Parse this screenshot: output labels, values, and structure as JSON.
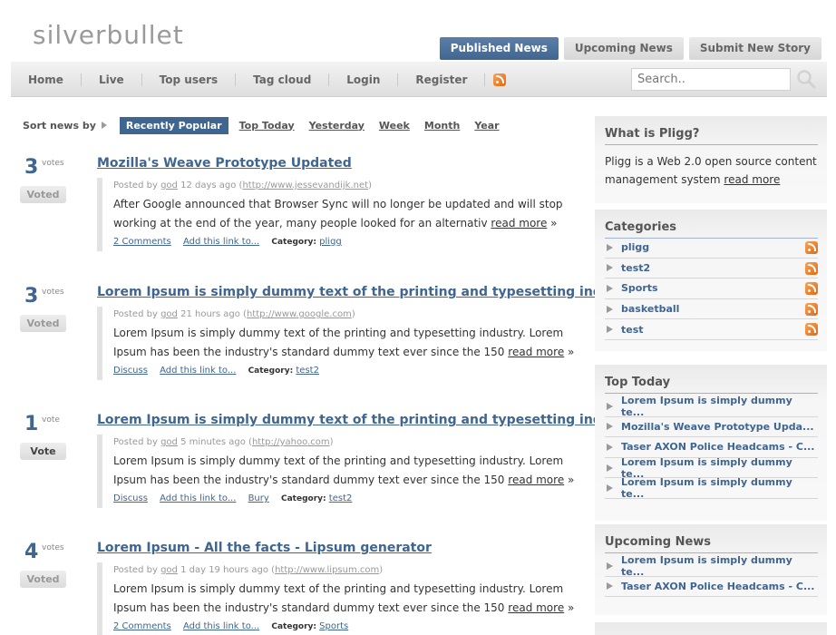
{
  "site": {
    "logo": "silverbullet"
  },
  "top_tabs": [
    {
      "label": "Published News",
      "active": true
    },
    {
      "label": "Upcoming News",
      "active": false
    },
    {
      "label": "Submit New Story",
      "active": false
    }
  ],
  "nav": {
    "items": [
      "Home",
      "Live",
      "Top users",
      "Tag cloud",
      "Login",
      "Register"
    ],
    "search_placeholder": "Search.."
  },
  "sort": {
    "label": "Sort news by",
    "options": [
      "Recently Popular",
      "Top Today",
      "Yesterday",
      "Week",
      "Month",
      "Year"
    ],
    "active": "Recently Popular"
  },
  "stories": [
    {
      "votes": "3",
      "vote_word": "votes",
      "button": "Voted",
      "title": "Mozilla's Weave Prototype Updated",
      "posted_by": "Posted by",
      "author": "god",
      "age": "12 days ago",
      "url": "http://www.jessevandijk.net",
      "excerpt": "After Google announced that Browser Sync will no longer be updated and will stop working at the end of the year, many people looked for an alternativ",
      "read_more": "read more",
      "links": [
        "2 Comments",
        "Add this link to..."
      ],
      "category_label": "Category:",
      "category": "pligg"
    },
    {
      "votes": "3",
      "vote_word": "votes",
      "button": "Voted",
      "title": "Lorem Ipsum is simply dummy text of the printing and typesetting industry.",
      "posted_by": "Posted by",
      "author": "god",
      "age": "21 hours ago",
      "url": "http://www.google.com",
      "excerpt": "Lorem Ipsum is simply dummy text of the printing and typesetting industry. Lorem Ipsum has been the industry's standard dummy text ever since the 150",
      "read_more": "read more",
      "links": [
        "Discuss",
        "Add this link to..."
      ],
      "category_label": "Category:",
      "category": "test2"
    },
    {
      "votes": "1",
      "vote_word": "vote",
      "button": "Vote",
      "title": "Lorem Ipsum is simply dummy text of the printing and typesetting industry.",
      "posted_by": "Posted by",
      "author": "god",
      "age": "5 minutes ago",
      "url": "http://yahoo.com",
      "excerpt": "Lorem Ipsum is simply dummy text of the printing and typesetting industry. Lorem Ipsum has been the industry's standard dummy text ever since the 150",
      "read_more": "read more",
      "links": [
        "Discuss",
        "Add this link to...",
        "Bury"
      ],
      "category_label": "Category:",
      "category": "test2"
    },
    {
      "votes": "4",
      "vote_word": "votes",
      "button": "Voted",
      "title": "Lorem Ipsum - All the facts - Lipsum generator",
      "posted_by": "Posted by",
      "author": "god",
      "age": "1 day 19 hours ago",
      "url": "http://www.lipsum.com",
      "excerpt": "Lorem Ipsum is simply dummy text of the printing and typesetting industry. Lorem Ipsum has been the industry's standard dummy text ever since the 150",
      "read_more": "read more",
      "links": [
        "2 Comments",
        "Add this link to..."
      ],
      "category_label": "Category:",
      "category": "Sports"
    }
  ],
  "sidebar": {
    "about": {
      "title": "What is Pligg?",
      "text": "Pligg is a Web 2.0 open source content management system",
      "read_more": "read more"
    },
    "categories": {
      "title": "Categories",
      "items": [
        "pligg",
        "test2",
        "Sports",
        "basketball",
        "test"
      ]
    },
    "top_today": {
      "title": "Top Today",
      "items": [
        "Lorem Ipsum is simply dummy te...",
        "Mozilla's Weave Prototype Upda...",
        "Taser AXON Police Headcams - C...",
        "Lorem Ipsum is simply dummy te...",
        "Lorem Ipsum is simply dummy te..."
      ]
    },
    "upcoming": {
      "title": "Upcoming News",
      "items": [
        "Lorem Ipsum is simply dummy te...",
        "Taser AXON Police Headcams - C..."
      ]
    }
  },
  "colors": {
    "accent": "#3f6591",
    "link": "#3f6591",
    "rss": "#e8791e"
  }
}
